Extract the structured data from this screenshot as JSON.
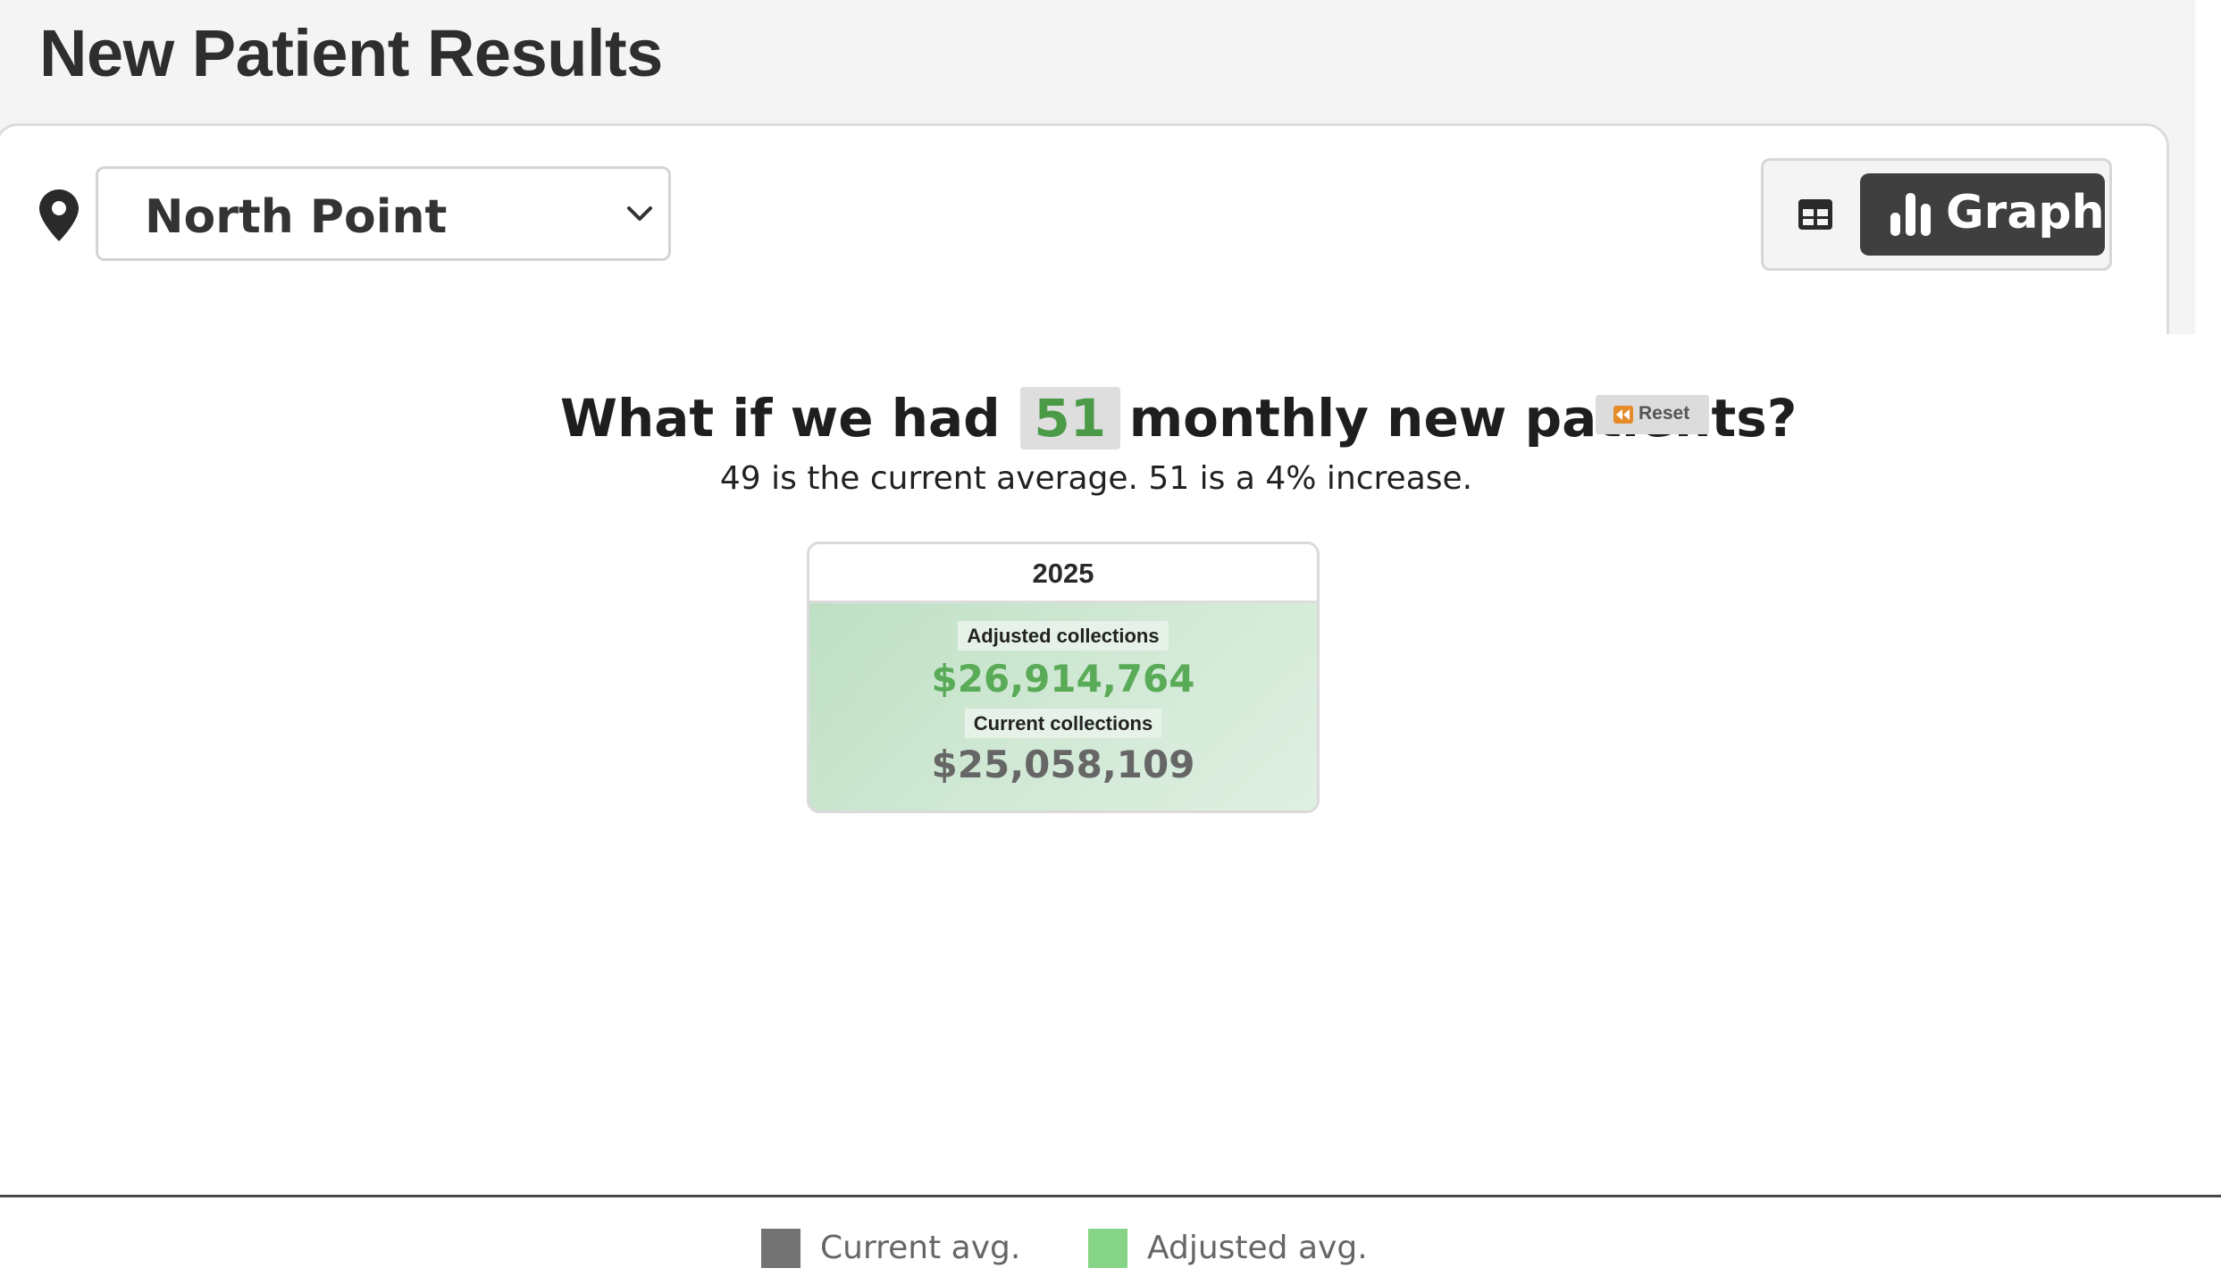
{
  "header": {
    "title": "New Patient Results"
  },
  "filters": {
    "location_icon": "map-pin-icon",
    "location_value": "North Point"
  },
  "view_toggle": {
    "table_icon": "table-icon",
    "graph_icon": "bar-chart-icon",
    "graph_label": "Graph",
    "active": "graph"
  },
  "scenario": {
    "question_prefix": "What if we had",
    "new_patients_value": "51",
    "question_suffix": "monthly new patients?",
    "reset_icon": "rewind-icon",
    "reset_label": "Reset",
    "summary": "49 is the current average. 51 is a 4% increase."
  },
  "result_card": {
    "year": "2025",
    "adjusted_label": "Adjusted collections",
    "adjusted_value": "$26,914,764",
    "current_label": "Current collections",
    "current_value": "$25,058,109"
  },
  "legend": {
    "current_label": "Current avg.",
    "current_color": "#737373",
    "adjusted_label": "Adjusted avg.",
    "adjusted_color": "#86d486"
  },
  "colors": {
    "accent_green": "#4a9a47",
    "current_gray": "#666666",
    "dark_button": "#3f3f3f"
  }
}
